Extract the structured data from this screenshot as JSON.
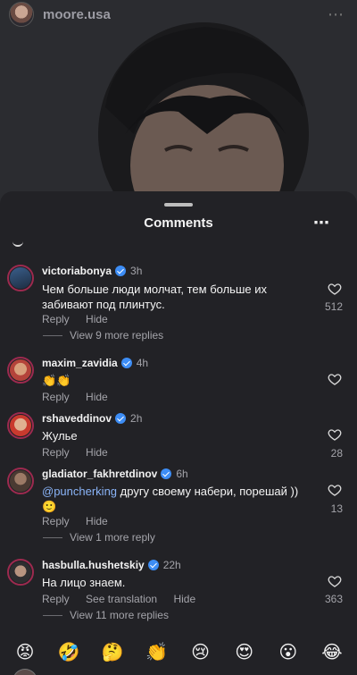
{
  "post": {
    "username": "moore.usa",
    "more_icon": "⋯"
  },
  "sheet": {
    "title": "Comments",
    "more_icon": "⋯"
  },
  "comments": [
    {
      "username": "victoriabonya",
      "verified": true,
      "time": "3h",
      "text": "Чем больше люди молчат, тем больше их забивают под плинтус.",
      "reply": "Reply",
      "hide": "Hide",
      "likes": "512",
      "more_replies": "View 9 more replies",
      "avatar_color": "#3a5f8c"
    },
    {
      "username": "maxim_zavidia",
      "verified": true,
      "time": "4h",
      "text": "👏👏",
      "reply": "Reply",
      "hide": "Hide",
      "likes": "",
      "avatar_color": "#b4433a"
    },
    {
      "username": "rshaveddinov",
      "verified": true,
      "time": "2h",
      "text": "Жулье",
      "reply": "Reply",
      "hide": "Hide",
      "likes": "28",
      "avatar_color": "#c93a2e"
    },
    {
      "username": "gladiator_fakhretdinov",
      "verified": true,
      "time": "6h",
      "mention": "@puncherking",
      "text": " другу своему набери, порешай ))",
      "text_line2": "🙂",
      "reply": "Reply",
      "hide": "Hide",
      "likes": "13",
      "more_replies": "View 1 more reply",
      "avatar_color": "#6b5a4e"
    },
    {
      "username": "hasbulla.hushetskiy",
      "verified": true,
      "time": "22h",
      "text": "На лицо знаем.",
      "reply": "Reply",
      "see_translation": "See translation",
      "hide": "Hide",
      "likes": "363",
      "more_replies": "View 11 more replies",
      "avatar_color": "#4a4a4a"
    }
  ],
  "emoji_bar": [
    "😡",
    "🤣",
    "🤔",
    "👏",
    "😢",
    "😍",
    "😮",
    "😂"
  ],
  "colors": {
    "sheet_bg": "#222226",
    "verified": "#3d8df5",
    "mention": "#8ab4f8",
    "secondary_text": "#a4a4aa"
  }
}
